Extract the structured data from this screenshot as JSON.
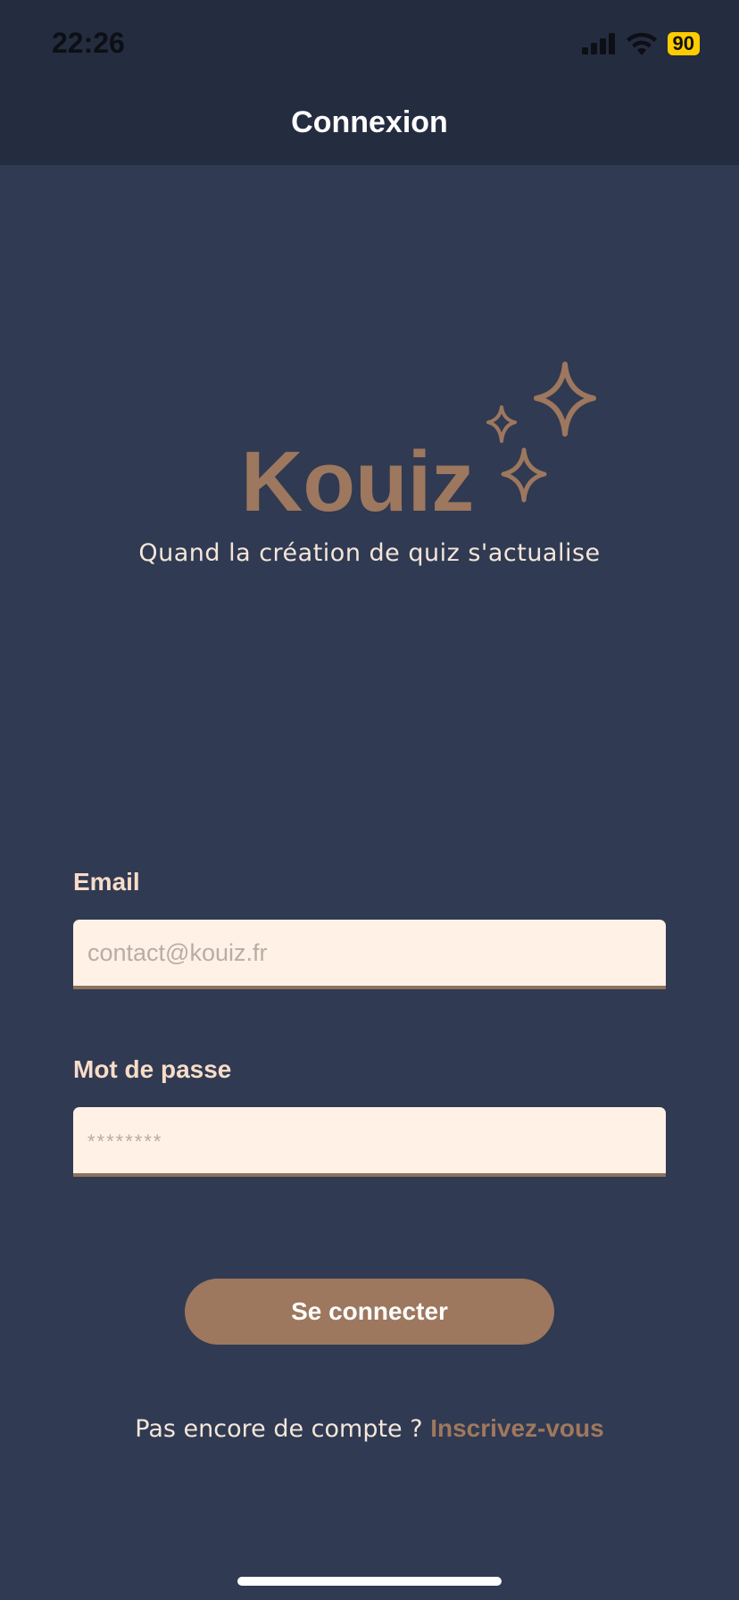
{
  "status_bar": {
    "time": "22:26",
    "battery": "90"
  },
  "nav": {
    "title": "Connexion"
  },
  "brand": {
    "name": "Kouiz",
    "tagline": "Quand la création de quiz s'actualise",
    "color": "#9d775e"
  },
  "form": {
    "email": {
      "label": "Email",
      "placeholder": "contact@kouiz.fr",
      "value": ""
    },
    "password": {
      "label": "Mot de passe",
      "placeholder": "********",
      "value": ""
    },
    "submit_label": "Se connecter"
  },
  "signup": {
    "prompt": "Pas encore de compte ?",
    "link": "Inscrivez-vous"
  },
  "colors": {
    "background": "#303a52",
    "header": "#242c40",
    "accent": "#9d775e",
    "field_bg": "#fff1e6"
  }
}
